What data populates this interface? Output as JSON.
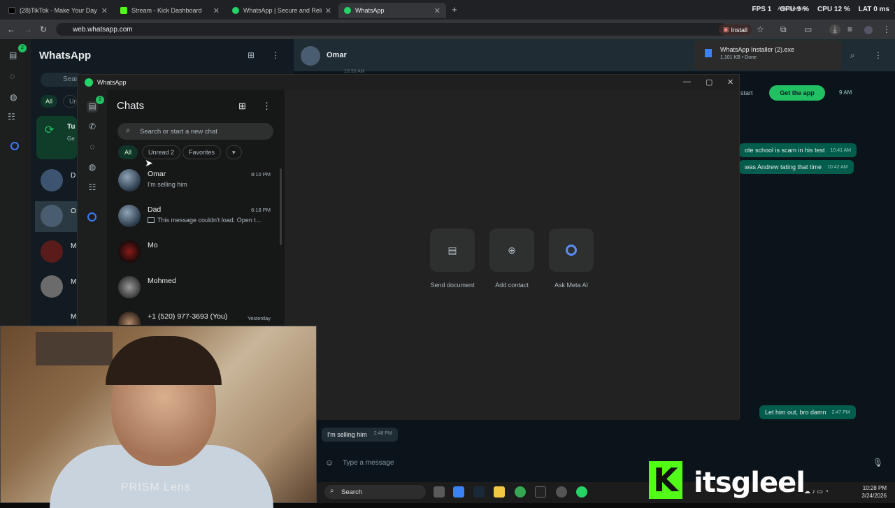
{
  "browser": {
    "tabs": [
      {
        "title": "(28)TikTok - Make Your Day",
        "color": "#000000"
      },
      {
        "title": "Stream - Kick Dashboard",
        "color": "#53fc18"
      },
      {
        "title": "WhatsApp | Secure and Reliab...",
        "color": "#25d366"
      },
      {
        "title": "WhatsApp",
        "color": "#25d366"
      }
    ],
    "new_tab": "+",
    "url": "web.whatsapp.com",
    "install_label": "Install",
    "ask_gemini": "Ask Gemini",
    "stats": {
      "fps_label": "FPS",
      "fps": "1",
      "gpu_label": "GPU",
      "gpu": "9 %",
      "cpu_label": "CPU",
      "cpu": "12 %",
      "lat_label": "LAT",
      "lat": "0 ms"
    }
  },
  "download": {
    "filename": "WhatsApp Installer (2).exe",
    "status": "1,101 KB • Done"
  },
  "background_app": {
    "title": "WhatsApp",
    "header_name": "Omar",
    "search_partial": "Sear",
    "chip_all": "All",
    "chip_partial": "Ur",
    "badge": "2",
    "list_letters": [
      "D",
      "O",
      "M",
      "M",
      "M"
    ],
    "tu": "Tu",
    "ge": "Ge",
    "get_app": "Get the app",
    "start_text": "start",
    "msg_time_top": "9 AM",
    "msg_time_faint": "10:39 AM",
    "out_msgs": [
      {
        "text": "ote school is scam in his test",
        "time": "10:41 AM"
      },
      {
        "text": "was Andrew tating that time",
        "time": "10:42 AM"
      },
      {
        "text": "Let him out, bro damn",
        "time": "2:47 PM"
      }
    ],
    "in_msg": {
      "text": "I'm selling him",
      "time": "2:48 PM"
    },
    "composer_placeholder": "Type a message"
  },
  "window": {
    "title": "WhatsApp",
    "rail_badge": "2",
    "chats_heading": "Chats",
    "search_placeholder": "Search or start a new chat",
    "chips": {
      "all": "All",
      "unread": "Unread 2",
      "favorites": "Favorites",
      "more": "▾"
    },
    "chats": [
      {
        "name": "Omar",
        "preview": "I'm selling him",
        "time": "8:10 PM"
      },
      {
        "name": "Dad",
        "preview": "This message couldn't load. Open t...",
        "time": "6:18 PM"
      },
      {
        "name": "Mo",
        "preview": "",
        "time": ""
      },
      {
        "name": "Mohmed",
        "preview": "",
        "time": ""
      },
      {
        "name": "+1 (520) 977-3693 (You)",
        "preview": "",
        "time": "Yesterday"
      }
    ],
    "actions": {
      "send_document": "Send document",
      "add_contact": "Add contact",
      "ask_meta_ai": "Ask Meta AI"
    }
  },
  "webcam": {
    "overlay_text": "PRISM Lens"
  },
  "taskbar": {
    "search": "Search",
    "time": "10:28 PM",
    "date": "3/24/2026"
  },
  "watermark": {
    "logo_letter": "K",
    "text": "itsgleel"
  }
}
